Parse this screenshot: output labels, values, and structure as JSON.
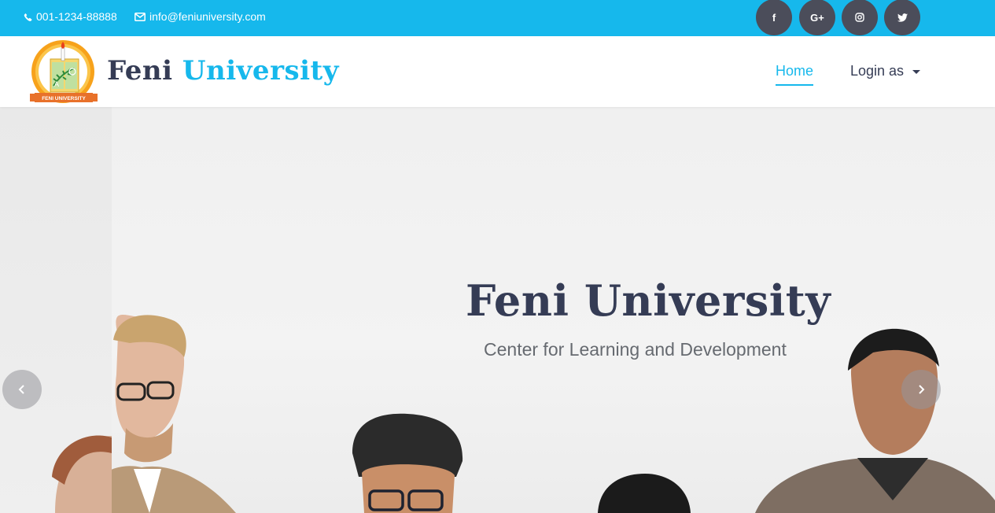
{
  "topbar": {
    "phone": "001-1234-88888",
    "email": "info@feniuniversity.com",
    "social": [
      {
        "icon": "facebook-icon",
        "label": "f"
      },
      {
        "icon": "google-plus-icon",
        "label": "G+"
      },
      {
        "icon": "instagram-icon",
        "label": ""
      },
      {
        "icon": "twitter-icon",
        "label": ""
      }
    ]
  },
  "navbar": {
    "brand_part1": "Feni",
    "brand_part2": "University",
    "logo_text": "FENI UNIVERSITY",
    "home": "Home",
    "login": "Login as"
  },
  "hero": {
    "title": "Feni University",
    "subtitle": "Center for Learning and Development"
  },
  "colors": {
    "accent": "#16b8ec",
    "brand_dark": "#353c55",
    "social_bg": "#4b4d5a"
  }
}
